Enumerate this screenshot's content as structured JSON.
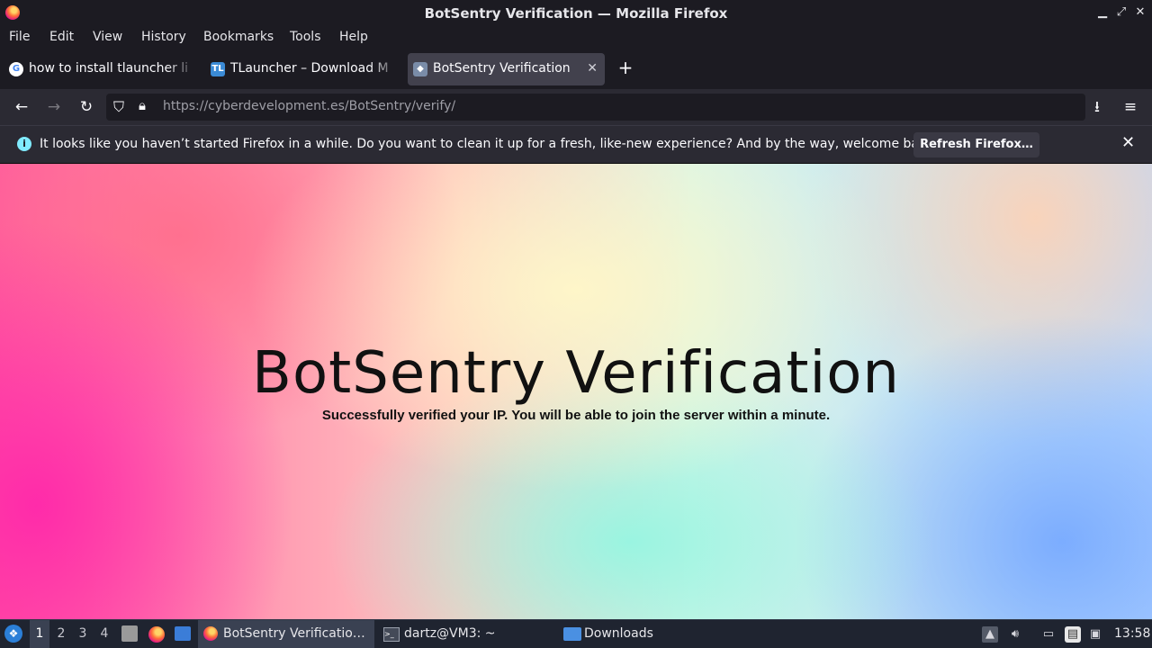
{
  "window": {
    "title": "BotSentry Verification — Mozilla Firefox",
    "controls": [
      "minimize-icon",
      "restore-icon",
      "close-icon"
    ]
  },
  "menubar": {
    "items": [
      "File",
      "Edit",
      "View",
      "History",
      "Bookmarks",
      "Tools",
      "Help"
    ]
  },
  "tabs": [
    {
      "label": "how to install tlauncher li",
      "favicon": "google-icon",
      "active": false
    },
    {
      "label": "TLauncher – Download M",
      "favicon": "TL",
      "active": false
    },
    {
      "label": "BotSentry Verification",
      "favicon": "botsentry-icon",
      "active": true
    }
  ],
  "newtab_label": "+",
  "navbar": {
    "url_host": "https://cyberdevelopment.es",
    "url_path": "/BotSentry/verify/"
  },
  "notification": {
    "message": "It looks like you haven’t started Firefox in a while. Do you want to clean it up for a fresh, like-new experience? And by the way, welcome back!",
    "button": "Refresh Firefox…"
  },
  "page": {
    "title": "BotSentry Verification",
    "subtitle": "Successfully verified your IP. You will be able to join the server within a minute."
  },
  "taskbar": {
    "workspaces": [
      "1",
      "2",
      "3",
      "4"
    ],
    "active_workspace": "1",
    "windows": [
      {
        "label": "BotSentry Verificatio…",
        "icon": "firefox-icon"
      },
      {
        "label": "dartz@VM3: ~",
        "icon": "terminal-icon"
      },
      {
        "label": "Downloads",
        "icon": "folder-icon"
      }
    ],
    "clock": "13:58"
  },
  "colors": {
    "chrome_bg": "#1c1b22",
    "toolbar_bg": "#2b2a33",
    "taskbar_bg": "#1f2430",
    "info_accent": "#80ebff"
  }
}
